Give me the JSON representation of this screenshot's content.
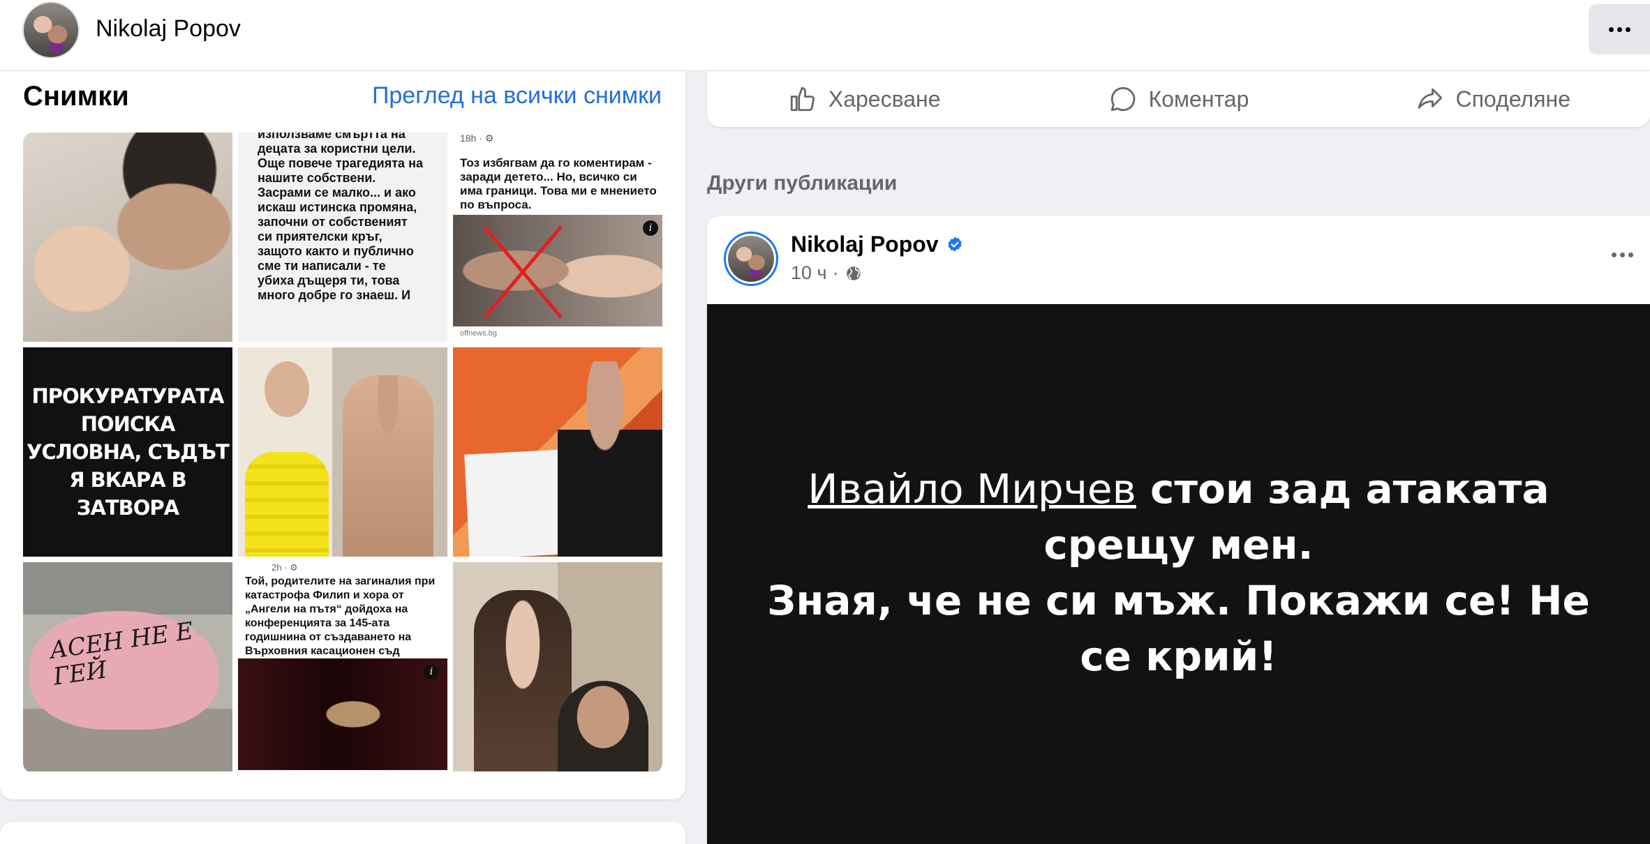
{
  "header": {
    "profile_name": "Nikolaj Popov",
    "more_icon": "more-horizontal-icon"
  },
  "photos": {
    "title": "Снимки",
    "see_all_link": "Преглед на всички снимки",
    "items": [
      {
        "alt": ""
      },
      {
        "text": "използваме смъртта на децата за користни цели. Още повече трагедията на нашите собствени. Засрами се малко... и ако искаш истинска промяна, започни от собственият си приятелски кръг, защото както и публично сме ти написали - те убиха дъщеря ти, това много добре го знаеш. И"
      },
      {
        "header": "18h · ⚙",
        "text": "Тоз избягвам да го коментирам - заради детето... Но, всичко си има граници. Това ми е мнението по въпроса.",
        "source": "offnews.bg"
      },
      {
        "text": "ПРОКУРАТУРАТА ПОИСКА УСЛОВНА, СЪДЪТ Я ВКАРА В ЗАТВОРА"
      },
      {
        "alt": ""
      },
      {
        "alt": ""
      },
      {
        "graffiti": "АСЕН НЕ Е ГЕЙ"
      },
      {
        "header": "2h · ⚙",
        "text": "Той, родителите на загиналия при катастрофа Филип и хора от „Ангели на пътя“ дойдоха на конференцията за 145-ата годишнина от създаването на Върховния касационен съд"
      },
      {
        "alt": ""
      }
    ]
  },
  "actions": {
    "like": "Харесване",
    "comment": "Коментар",
    "share": "Споделяне"
  },
  "other_posts_label": "Други публикации",
  "post": {
    "author": "Nikolaj Popov",
    "verified_icon": "verified-badge-icon",
    "time": "10 ч",
    "separator": "·",
    "privacy_icon": "globe-icon",
    "mention": "Ивайло Мирчев",
    "line1_rest": " стои зад атаката срещу мен.",
    "line2": "Зная, че не си мъж. Покажи се! Не се крий!"
  },
  "colors": {
    "link_blue": "#216fdb",
    "verified_blue": "#1877f2",
    "secondary_text": "#65676b",
    "page_bg": "#eef0f3"
  }
}
